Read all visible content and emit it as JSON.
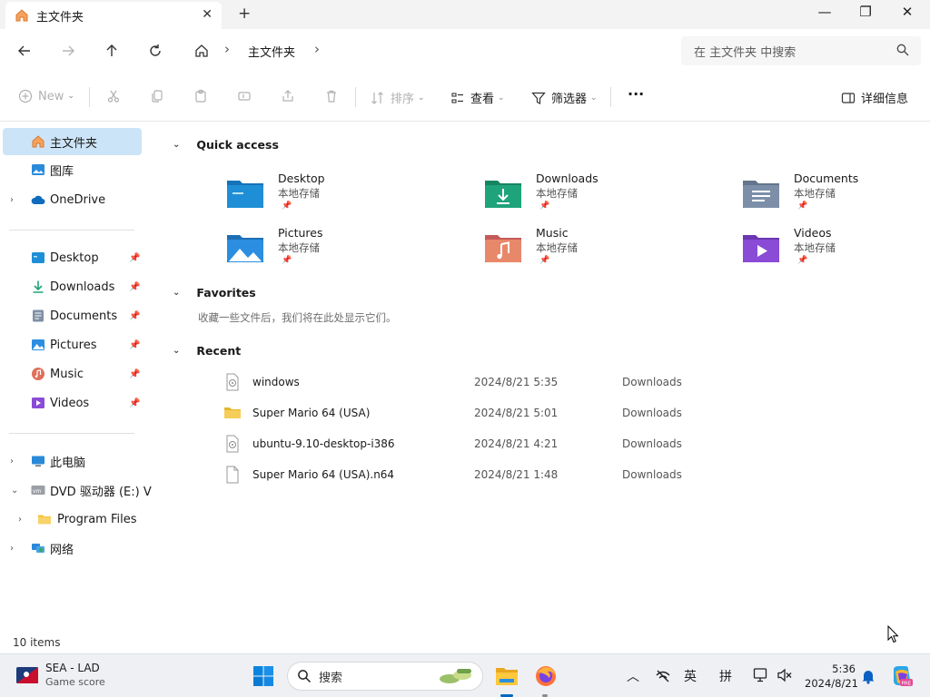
{
  "window": {
    "tab_title": "主文件夹",
    "new_tab": "+",
    "close_tab": "✕",
    "minimize": "—",
    "maximize": "❐",
    "close": "✕"
  },
  "address": {
    "breadcrumb": [
      "主文件夹"
    ],
    "search_placeholder": "在 主文件夹 中搜索"
  },
  "commandbar": {
    "new_label": "New",
    "sort_label": "排序",
    "view_label": "查看",
    "filter_label": "筛选器",
    "more_label": "···",
    "details_label": "详细信息"
  },
  "sidebar": {
    "top": [
      {
        "label": "主文件夹",
        "icon": "home-icon",
        "selected": true
      },
      {
        "label": "图库",
        "icon": "gallery-icon"
      },
      {
        "label": "OneDrive",
        "icon": "cloud-icon",
        "expandable": true
      }
    ],
    "pinned": [
      {
        "label": "Desktop",
        "icon": "desktop-icon"
      },
      {
        "label": "Downloads",
        "icon": "download-icon"
      },
      {
        "label": "Documents",
        "icon": "document-icon"
      },
      {
        "label": "Pictures",
        "icon": "picture-icon"
      },
      {
        "label": "Music",
        "icon": "music-icon"
      },
      {
        "label": "Videos",
        "icon": "video-icon"
      }
    ],
    "devices": [
      {
        "label": "此电脑",
        "icon": "pc-icon"
      },
      {
        "label": "DVD 驱动器 (E:) V",
        "icon": "dvd-icon"
      },
      {
        "label": "Program Files",
        "icon": "folder-icon"
      },
      {
        "label": "网络",
        "icon": "network-icon"
      }
    ]
  },
  "quick_access": {
    "title": "Quick access",
    "items": [
      {
        "name": "Desktop",
        "sub": "本地存储",
        "color": "#1e8fd6"
      },
      {
        "name": "Downloads",
        "sub": "本地存储",
        "color": "#1fa37a"
      },
      {
        "name": "Documents",
        "sub": "本地存储",
        "color": "#7d8fa8"
      },
      {
        "name": "Pictures",
        "sub": "本地存储",
        "color": "#2b8ee0"
      },
      {
        "name": "Music",
        "sub": "本地存储",
        "color": "#e0705a"
      },
      {
        "name": "Videos",
        "sub": "本地存储",
        "color": "#8a4bd6"
      }
    ]
  },
  "favorites": {
    "title": "Favorites",
    "empty_text": "收藏一些文件后，我们将在此处显示它们。"
  },
  "recent": {
    "title": "Recent",
    "rows": [
      {
        "name": "windows",
        "date": "2024/8/21 5:35",
        "location": "Downloads",
        "icon": "disc-file-icon"
      },
      {
        "name": "Super Mario 64 (USA)",
        "date": "2024/8/21 5:01",
        "location": "Downloads",
        "icon": "folder-icon"
      },
      {
        "name": "ubuntu-9.10-desktop-i386",
        "date": "2024/8/21 4:21",
        "location": "Downloads",
        "icon": "disc-file-icon"
      },
      {
        "name": "Super Mario 64 (USA).n64",
        "date": "2024/8/21 1:48",
        "location": "Downloads",
        "icon": "file-icon"
      }
    ]
  },
  "status": {
    "items_count": "10 items"
  },
  "taskbar": {
    "weather_line1": "SEA - LAD",
    "weather_line2": "Game score",
    "search_label": "搜索",
    "tray_lang1": "英",
    "tray_lang2": "拼",
    "time": "5:36",
    "date": "2024/8/21"
  }
}
